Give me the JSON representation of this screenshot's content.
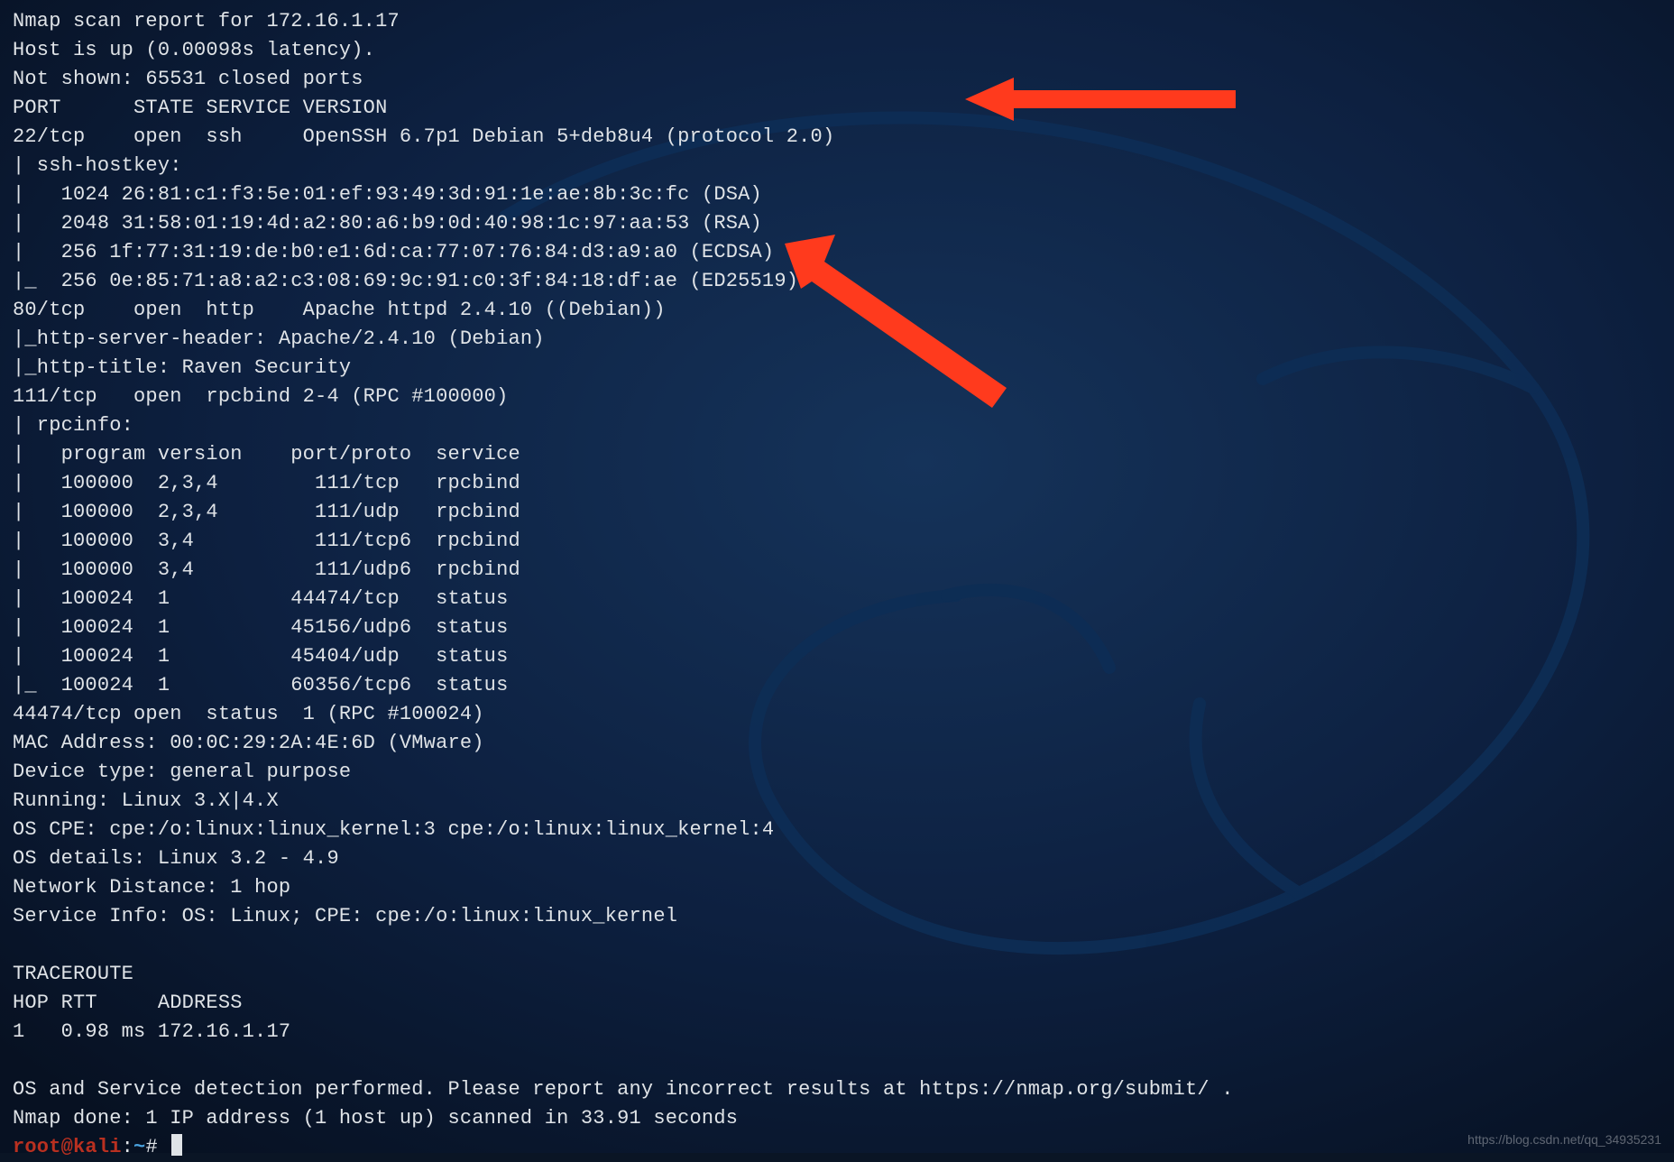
{
  "scan": {
    "headerLine": "Nmap scan report for 172.16.1.17",
    "hostLine": "Host is up (0.00098s latency).",
    "notShown": "Not shown: 65531 closed ports",
    "colHeader": "PORT      STATE SERVICE VERSION",
    "ports": {
      "ssh": "22/tcp    open  ssh     OpenSSH 6.7p1 Debian 5+deb8u4 (protocol 2.0)",
      "sshHostkeyHeader": "| ssh-hostkey:",
      "sshKeys": [
        "|   1024 26:81:c1:f3:5e:01:ef:93:49:3d:91:1e:ae:8b:3c:fc (DSA)",
        "|   2048 31:58:01:19:4d:a2:80:a6:b9:0d:40:98:1c:97:aa:53 (RSA)",
        "|   256 1f:77:31:19:de:b0:e1:6d:ca:77:07:76:84:d3:a9:a0 (ECDSA)",
        "|_  256 0e:85:71:a8:a2:c3:08:69:9c:91:c0:3f:84:18:df:ae (ED25519)"
      ],
      "http": "80/tcp    open  http    Apache httpd 2.4.10 ((Debian))",
      "httpExtras": [
        "|_http-server-header: Apache/2.4.10 (Debian)",
        "|_http-title: Raven Security"
      ],
      "rpc": "111/tcp   open  rpcbind 2-4 (RPC #100000)",
      "rpcHeader": "| rpcinfo:",
      "rpcCols": "|   program version    port/proto  service",
      "rpcRows": [
        "|   100000  2,3,4        111/tcp   rpcbind",
        "|   100000  2,3,4        111/udp   rpcbind",
        "|   100000  3,4          111/tcp6  rpcbind",
        "|   100000  3,4          111/udp6  rpcbind",
        "|   100024  1          44474/tcp   status",
        "|   100024  1          45156/udp6  status",
        "|   100024  1          45404/udp   status",
        "|_  100024  1          60356/tcp6  status"
      ],
      "status": "44474/tcp open  status  1 (RPC #100024)"
    },
    "mac": "MAC Address: 00:0C:29:2A:4E:6D (VMware)",
    "devtype": "Device type: general purpose",
    "running": "Running: Linux 3.X|4.X",
    "oscpe": "OS CPE: cpe:/o:linux:linux_kernel:3 cpe:/o:linux:linux_kernel:4",
    "osdet": "OS details: Linux 3.2 - 4.9",
    "netdist": "Network Distance: 1 hop",
    "svcinfo": "Service Info: OS: Linux; CPE: cpe:/o:linux:linux_kernel",
    "blank1": "",
    "trHeader": "TRACEROUTE",
    "trCols": "HOP RTT     ADDRESS",
    "trRow": "1   0.98 ms 172.16.1.17",
    "blank2": "",
    "footer1": "OS and Service detection performed. Please report any incorrect results at https://nmap.org/submit/ .",
    "footer2": "Nmap done: 1 IP address (1 host up) scanned in 33.91 seconds"
  },
  "prompt": {
    "user": "root",
    "at": "@",
    "host": "kali",
    "colon": ":",
    "path": "~",
    "hash": "#"
  },
  "watermark": "https://blog.csdn.net/qq_34935231"
}
